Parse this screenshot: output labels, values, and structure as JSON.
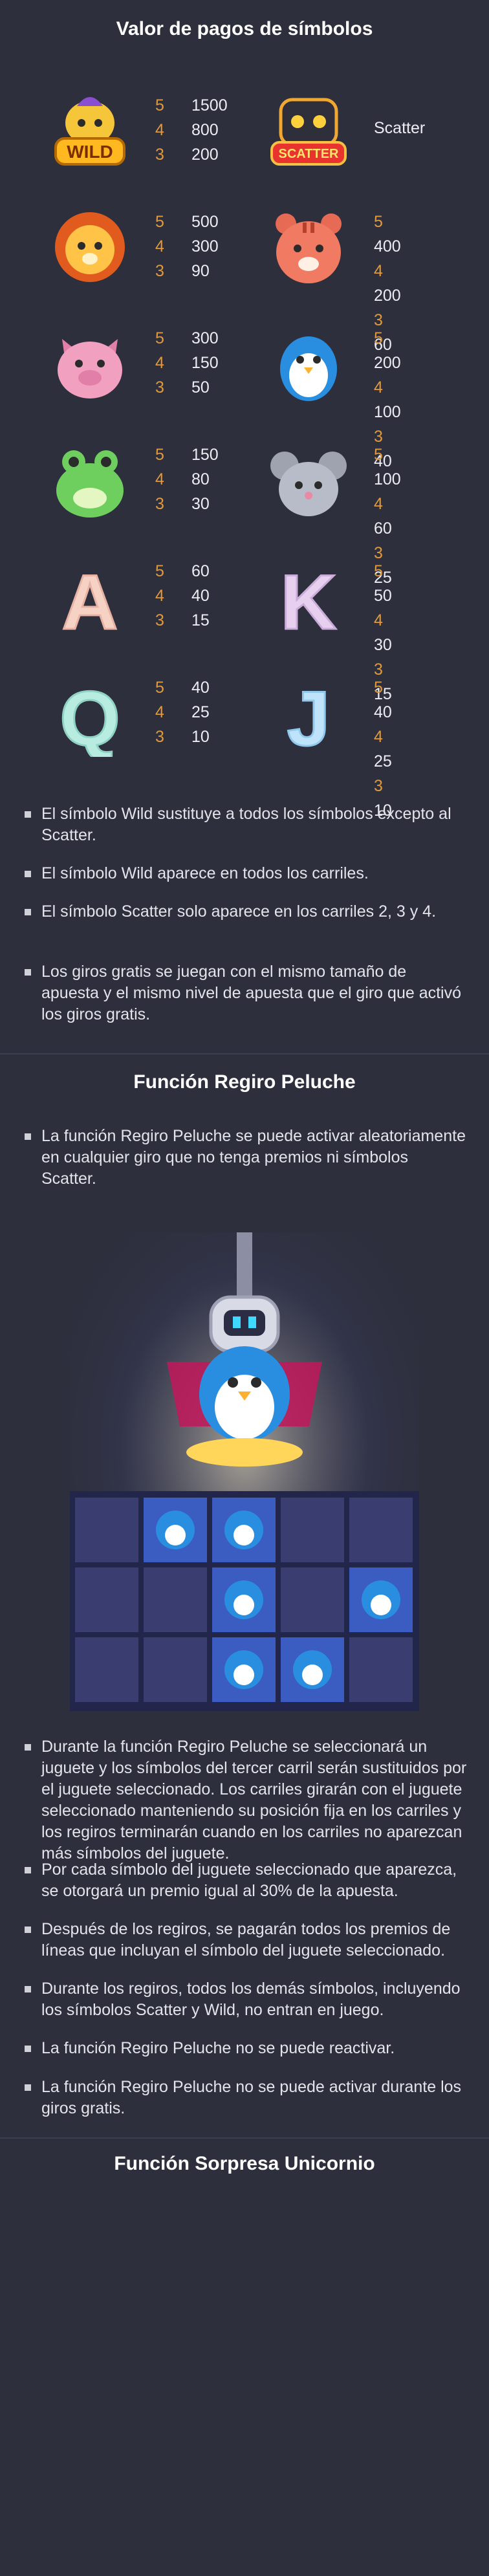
{
  "section1_title": "Valor de pagos de símbolos",
  "paytable": [
    {
      "symbol": "wild",
      "label": "WILD",
      "pays": [
        {
          "n": "5",
          "v": "1500"
        },
        {
          "n": "4",
          "v": "800"
        },
        {
          "n": "3",
          "v": "200"
        }
      ]
    },
    {
      "symbol": "scatter",
      "label": "SCATTER",
      "text": "Scatter"
    },
    {
      "symbol": "lion",
      "pays": [
        {
          "n": "5",
          "v": "500"
        },
        {
          "n": "4",
          "v": "300"
        },
        {
          "n": "3",
          "v": "90"
        }
      ]
    },
    {
      "symbol": "tiger",
      "pays": [
        {
          "n": "5",
          "v": "400"
        },
        {
          "n": "4",
          "v": "200"
        },
        {
          "n": "3",
          "v": "60"
        }
      ]
    },
    {
      "symbol": "pig",
      "pays": [
        {
          "n": "5",
          "v": "300"
        },
        {
          "n": "4",
          "v": "150"
        },
        {
          "n": "3",
          "v": "50"
        }
      ]
    },
    {
      "symbol": "penguin",
      "pays": [
        {
          "n": "5",
          "v": "200"
        },
        {
          "n": "4",
          "v": "100"
        },
        {
          "n": "3",
          "v": "40"
        }
      ]
    },
    {
      "symbol": "frog",
      "pays": [
        {
          "n": "5",
          "v": "150"
        },
        {
          "n": "4",
          "v": "80"
        },
        {
          "n": "3",
          "v": "30"
        }
      ]
    },
    {
      "symbol": "mouse",
      "pays": [
        {
          "n": "5",
          "v": "100"
        },
        {
          "n": "4",
          "v": "60"
        },
        {
          "n": "3",
          "v": "25"
        }
      ]
    },
    {
      "symbol": "letter-a",
      "letter": "A",
      "pays": [
        {
          "n": "5",
          "v": "60"
        },
        {
          "n": "4",
          "v": "40"
        },
        {
          "n": "3",
          "v": "15"
        }
      ]
    },
    {
      "symbol": "letter-k",
      "letter": "K",
      "pays": [
        {
          "n": "5",
          "v": "50"
        },
        {
          "n": "4",
          "v": "30"
        },
        {
          "n": "3",
          "v": "15"
        }
      ]
    },
    {
      "symbol": "letter-q",
      "letter": "Q",
      "pays": [
        {
          "n": "5",
          "v": "40"
        },
        {
          "n": "4",
          "v": "25"
        },
        {
          "n": "3",
          "v": "10"
        }
      ]
    },
    {
      "symbol": "letter-j",
      "letter": "J",
      "pays": [
        {
          "n": "5",
          "v": "40"
        },
        {
          "n": "4",
          "v": "25"
        },
        {
          "n": "3",
          "v": "10"
        }
      ]
    }
  ],
  "rules": [
    "El símbolo Wild sustituye a todos los símbolos excepto al Scatter.",
    "El símbolo Wild aparece en todos los carriles.",
    "El símbolo Scatter solo aparece en los carriles 2, 3 y 4.",
    "Los giros gratis se juegan con el mismo tamaño de apuesta y el mismo nivel de apuesta que el giro que activó los giros gratis."
  ],
  "section2_title": "Función Regiro Peluche",
  "feature_intro": "La función Regiro Peluche se puede activar aleatoriamente en cualquier giro que no tenga premios ni símbolos Scatter.",
  "feature_rules": [
    "Durante la función Regiro Peluche se seleccionará un juguete y los símbolos del tercer carril serán sustituidos por el juguete seleccionado. Los carriles girarán con el juguete seleccionado manteniendo su posición fija en los carriles y los regiros terminarán cuando en los carriles no aparezcan más símbolos del juguete.",
    "Por cada símbolo del juguete seleccionado que aparezca, se otorgará un premio igual al 30% de la apuesta.",
    "Después de los regiros, se pagarán todos los premios de líneas que incluyan el símbolo del juguete seleccionado.",
    "Durante los regiros, todos los demás símbolos, incluyendo los símbolos Scatter y Wild, no entran en juego.",
    "La función Regiro Peluche no se puede reactivar.",
    "La función Regiro Peluche no se puede activar durante los giros gratis."
  ],
  "section3_title": "Función Sorpresa Unicornio",
  "colors": {
    "background": "#2e2f3d",
    "multiplier": "#e09a3c",
    "text": "#e6e6ec"
  }
}
